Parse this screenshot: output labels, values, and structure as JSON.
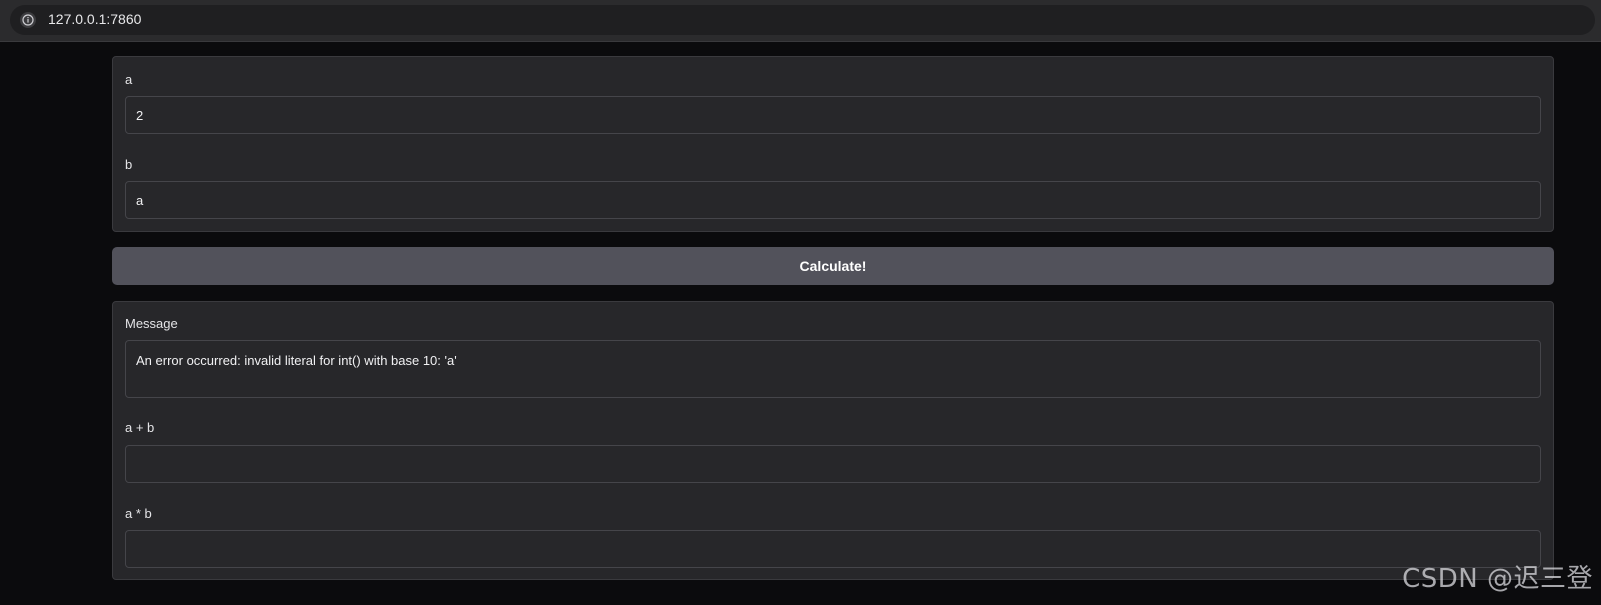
{
  "browser": {
    "url": "127.0.0.1:7860"
  },
  "inputs": {
    "a": {
      "label": "a",
      "value": "2"
    },
    "b": {
      "label": "b",
      "value": "a"
    }
  },
  "button": {
    "label": "Calculate!"
  },
  "outputs": {
    "message": {
      "label": "Message",
      "value": "An error occurred: invalid literal for int() with base 10: 'a'"
    },
    "sum": {
      "label": "a + b",
      "value": ""
    },
    "product": {
      "label": "a * b",
      "value": ""
    }
  },
  "watermark": {
    "text": "CSDN @迟三登"
  },
  "colors": {
    "background": "#0b0b0d",
    "panel": "#27272a",
    "button": "#52525b"
  }
}
